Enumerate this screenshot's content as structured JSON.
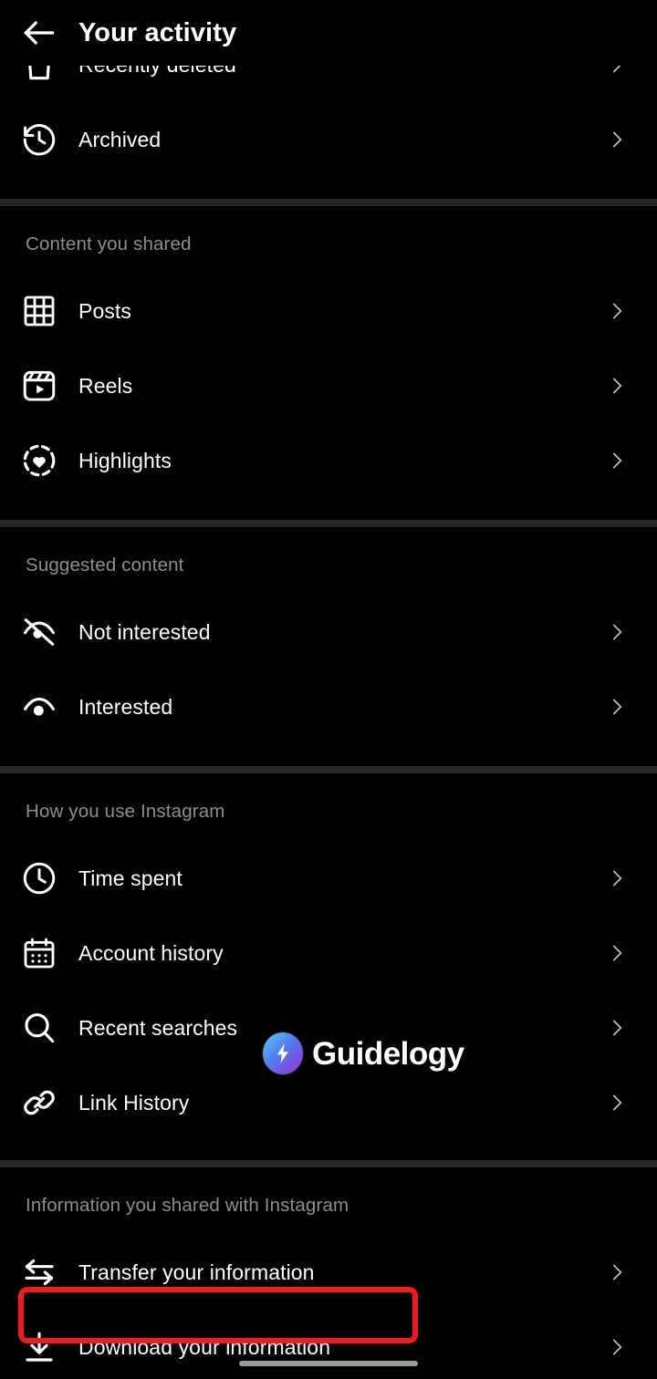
{
  "header": {
    "title": "Your activity",
    "back_icon": "arrow-left-icon"
  },
  "sections": [
    {
      "id": "your-activity-top",
      "title": "",
      "rows": [
        {
          "label": "Recently deleted",
          "icon": "trash-icon",
          "clipped": true
        },
        {
          "label": "Archived",
          "icon": "history-clock-icon"
        }
      ]
    },
    {
      "id": "content-you-shared",
      "title": "Content you shared",
      "rows": [
        {
          "label": "Posts",
          "icon": "grid-icon"
        },
        {
          "label": "Reels",
          "icon": "reels-icon"
        },
        {
          "label": "Highlights",
          "icon": "highlights-heart-icon"
        }
      ]
    },
    {
      "id": "suggested-content",
      "title": "Suggested content",
      "rows": [
        {
          "label": "Not interested",
          "icon": "eye-slash-icon"
        },
        {
          "label": "Interested",
          "icon": "eye-icon"
        }
      ]
    },
    {
      "id": "how-you-use-instagram",
      "title": "How you use Instagram",
      "rows": [
        {
          "label": "Time spent",
          "icon": "clock-icon"
        },
        {
          "label": "Account history",
          "icon": "calendar-icon"
        },
        {
          "label": "Recent searches",
          "icon": "search-icon"
        },
        {
          "label": "Link History",
          "icon": "link-icon"
        }
      ]
    },
    {
      "id": "information-you-shared",
      "title": "Information you shared with Instagram",
      "rows": [
        {
          "label": "Transfer your information",
          "icon": "transfer-arrows-icon"
        },
        {
          "label": "Download your information",
          "icon": "download-icon",
          "highlighted": true
        }
      ]
    }
  ],
  "watermark": {
    "text": "Guidelogy",
    "badge_icon": "lightning-bolt-icon"
  },
  "colors": {
    "background": "#000000",
    "divider": "#262626",
    "section_title": "#8e8e8e",
    "row_label": "#ffffff",
    "chevron": "#bdbdbd",
    "highlight": "#ef1c1c",
    "home_indicator": "#9a9a9a"
  },
  "chevron_icon": "chevron-right-icon"
}
